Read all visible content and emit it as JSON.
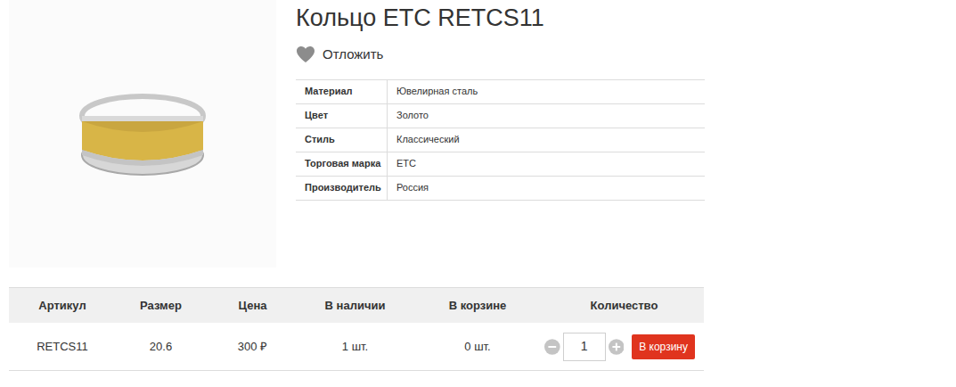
{
  "product": {
    "title": "Кольцо ETC RETCS11",
    "favorite_label": "Отложить"
  },
  "specs": [
    {
      "label": "Материал",
      "value": "Ювелирная сталь"
    },
    {
      "label": "Цвет",
      "value": "Золото"
    },
    {
      "label": "Стиль",
      "value": "Классический"
    },
    {
      "label": "Торговая марка",
      "value": "ETC"
    },
    {
      "label": "Производитель",
      "value": "Россия"
    }
  ],
  "table": {
    "columns": [
      "Артикул",
      "Размер",
      "Цена",
      "В наличии",
      "В корзине",
      "Количество"
    ],
    "rows": [
      {
        "article": "RETCS11",
        "size": "20.6",
        "price": "300 ₽",
        "stock": "1 шт.",
        "in_cart": "0 шт.",
        "quantity": "1",
        "button": "В корзину"
      }
    ]
  }
}
